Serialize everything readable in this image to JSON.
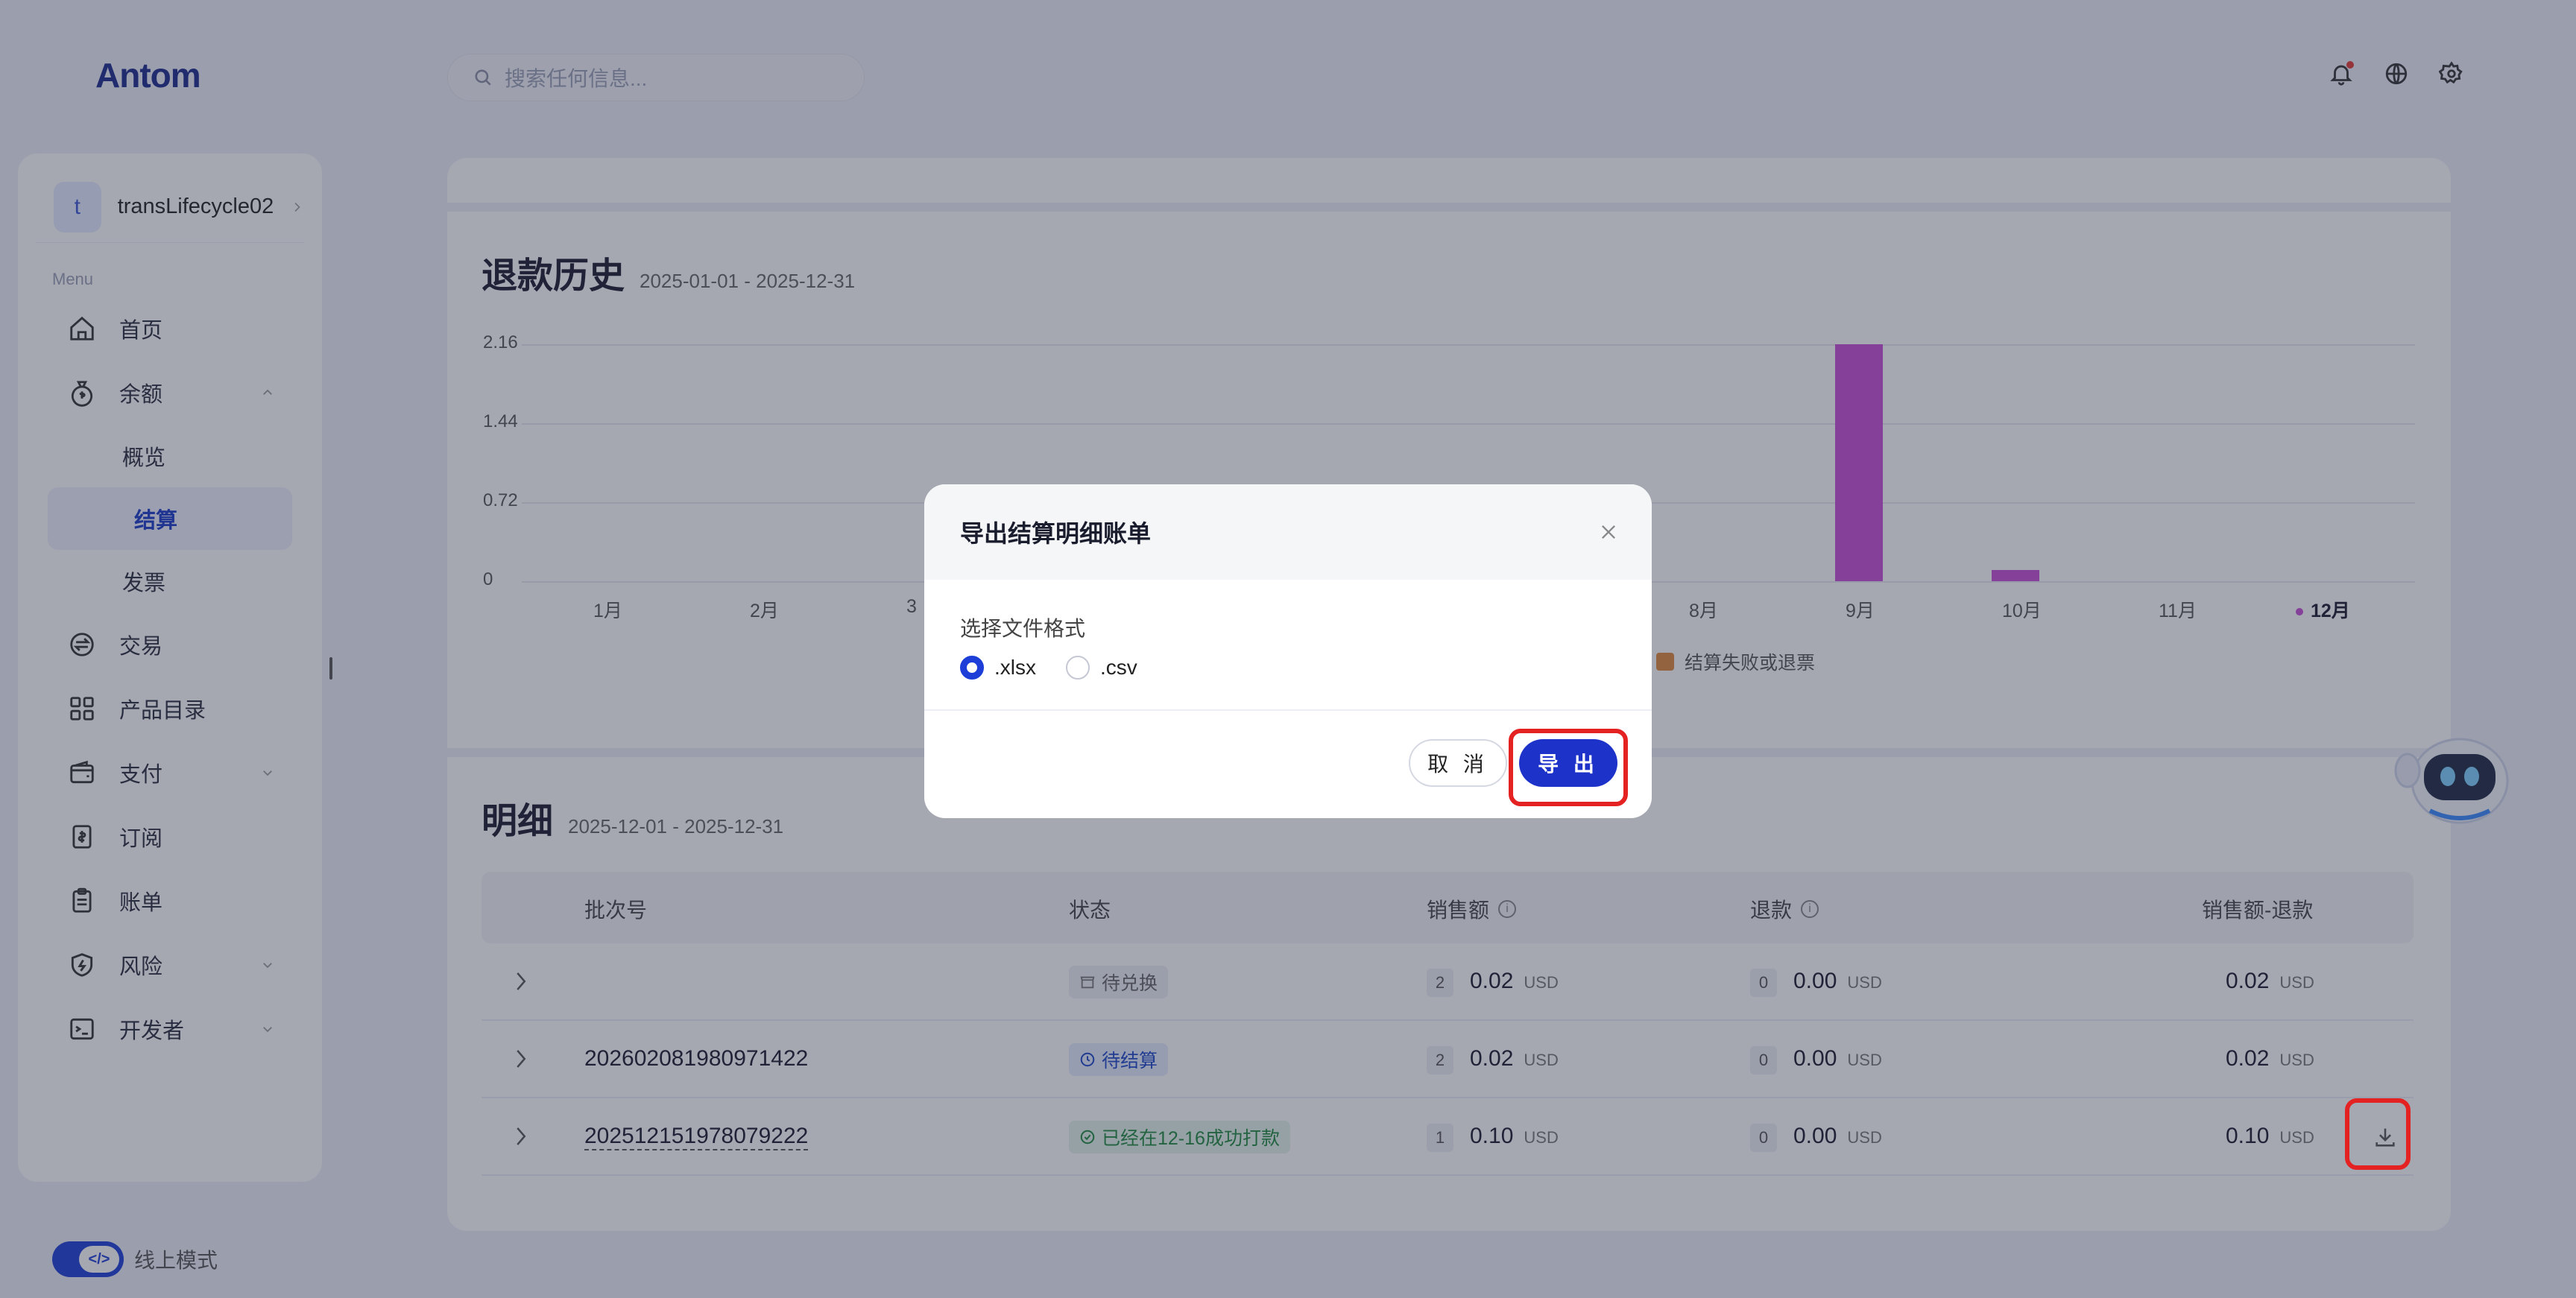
{
  "app": {
    "logo": "Antom"
  },
  "search": {
    "placeholder": "搜索任何信息..."
  },
  "topbar": {
    "icons": [
      "bell-icon",
      "globe-icon",
      "gear-icon"
    ]
  },
  "sidebar": {
    "account": {
      "initial": "t",
      "name": "transLifecycle02"
    },
    "menu_label": "Menu",
    "items": [
      {
        "label": "首页",
        "icon": "home-icon"
      },
      {
        "label": "余额",
        "icon": "money-bag-icon",
        "expanded": true,
        "children": [
          {
            "label": "概览"
          },
          {
            "label": "结算",
            "active": true
          },
          {
            "label": "发票"
          }
        ]
      },
      {
        "label": "交易",
        "icon": "exchange-icon"
      },
      {
        "label": "产品目录",
        "icon": "grid-icon"
      },
      {
        "label": "支付",
        "icon": "wallet-icon"
      },
      {
        "label": "订阅",
        "icon": "dollar-doc-icon"
      },
      {
        "label": "账单",
        "icon": "clipboard-icon"
      },
      {
        "label": "风险",
        "icon": "shield-icon"
      },
      {
        "label": "开发者",
        "icon": "terminal-icon"
      }
    ],
    "mode_label": "线上模式"
  },
  "refund_history": {
    "title": "退款历史",
    "range": "2025-01-01 - 2025-12-31",
    "legend": "结算失败或退票"
  },
  "chart_data": {
    "type": "bar",
    "title": "退款历史",
    "categories": [
      "1月",
      "2月",
      "3月",
      "4月",
      "5月",
      "6月",
      "7月",
      "8月",
      "9月",
      "10月",
      "11月",
      "12月"
    ],
    "values": [
      0,
      0,
      0,
      0,
      0,
      0,
      0,
      0,
      2.16,
      0.1,
      0,
      0
    ],
    "ylim": [
      0,
      2.16
    ],
    "yticks": [
      "0",
      "0.72",
      "1.44",
      "2.16"
    ],
    "visible_x_labels": [
      "1月",
      "2月",
      "3",
      "8月",
      "9月",
      "10月",
      "11月",
      "12月"
    ],
    "highlighted_category": "12月",
    "bar_color": "#c84fd8",
    "legend_color": "#e08a3c",
    "grid": true
  },
  "detail": {
    "title": "明细",
    "range": "2025-12-01 - 2025-12-31",
    "columns": {
      "batch": "批次号",
      "status": "状态",
      "sales": "销售额",
      "refund": "退款",
      "net": "销售额-退款"
    },
    "rows": [
      {
        "batch": "",
        "status": "待兑换",
        "sales_count": "2",
        "sales": "0.02",
        "refund_count": "0",
        "refund": "0.00",
        "net": "0.02",
        "currency": "USD"
      },
      {
        "batch": "202602081980971422",
        "status": "待结算",
        "sales_count": "2",
        "sales": "0.02",
        "refund_count": "0",
        "refund": "0.00",
        "net": "0.02",
        "currency": "USD"
      },
      {
        "batch": "202512151978079222",
        "status": "已经在12-16成功打款",
        "sales_count": "1",
        "sales": "0.10",
        "refund_count": "0",
        "refund": "0.00",
        "net": "0.10",
        "currency": "USD"
      }
    ]
  },
  "modal": {
    "title": "导出结算明细账单",
    "format_label": "选择文件格式",
    "options": [
      {
        "label": ".xlsx",
        "selected": true
      },
      {
        "label": ".csv",
        "selected": false
      }
    ],
    "cancel": "取 消",
    "export": "导 出"
  },
  "colors": {
    "accent": "#1d32c8",
    "highlight": "#e52222",
    "bar": "#c84fd8"
  }
}
